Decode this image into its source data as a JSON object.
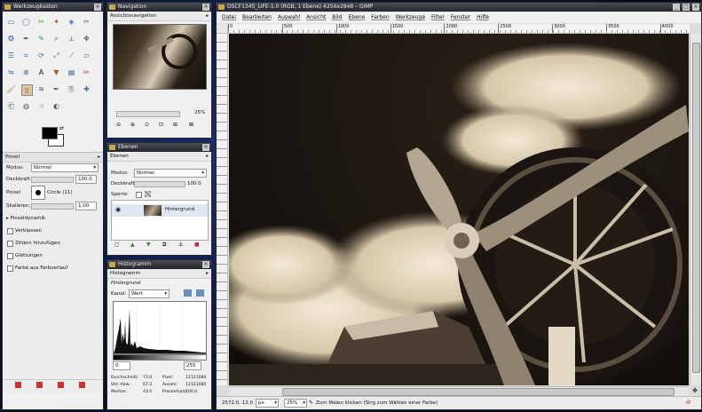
{
  "toolbox": {
    "title": "Werkzeugkasten",
    "tool_icons": [
      "rect-select",
      "ellipse-select",
      "free-select",
      "fuzzy-select",
      "color-select",
      "scissors",
      "foreground-select",
      "paths",
      "color-picker",
      "zoom",
      "measure",
      "move",
      "align",
      "crop",
      "rotate",
      "scale",
      "shear",
      "perspective",
      "flip",
      "cage",
      "text",
      "bucket-fill",
      "blend",
      "pencil",
      "paintbrush",
      "eraser",
      "airbrush",
      "ink",
      "clone",
      "heal",
      "perspective-clone",
      "blur",
      "smudge",
      "dodge-burn"
    ],
    "fg_color": "#000000",
    "bg_color": "#ffffff",
    "options": {
      "section": "Pinsel",
      "mode_label": "Modus:",
      "mode_value": "Normal",
      "opacity_label": "Deckkraft",
      "opacity_value": "100.0",
      "brush_label": "Pinsel",
      "brush_value": "Circle (11)",
      "scale_label": "Skalieren:",
      "scale_value": "1.00",
      "dynamics_label": "Pinseldynamik",
      "checkboxes": [
        "Verblassen",
        "Zittern hinzufügen",
        "Glättungen",
        "Farbe aus Farbverlauf"
      ]
    }
  },
  "navigation": {
    "title": "Navigation",
    "header": "Ansichtsnavigation",
    "zoom": "25%"
  },
  "layers": {
    "title": "Ebenen",
    "header": "Ebenen",
    "mode_label": "Modus:",
    "mode_value": "Normal",
    "opacity_label": "Deckkraft",
    "opacity_value": "100.0",
    "lock_label": "Sperre:",
    "layer_name": "Hintergrund"
  },
  "histogram": {
    "title": "Histogramm",
    "header": "Histogramm",
    "sub": "Hintergrund",
    "channel_label": "Kanal:",
    "channel_value": "Wert",
    "range_min": "0",
    "range_max": "255",
    "stats": [
      [
        "Durchschnitt:",
        "73.0",
        "Pixel:",
        "12121080"
      ],
      [
        "Std.-Abw.:",
        "67.3",
        "Anzahl:",
        "12121080"
      ],
      [
        "Median:",
        "43.0",
        "Prozentsatz:",
        "100.0"
      ]
    ]
  },
  "image_window": {
    "title": "DSCF1345_LIFE-1.0 (RGB, 1 Ebene) 4256x2848 – GIMP",
    "menu": [
      "Datei",
      "Bearbeiten",
      "Auswahl",
      "Ansicht",
      "Bild",
      "Ebene",
      "Farben",
      "Werkzeuge",
      "Filter",
      "Fenster",
      "Hilfe"
    ],
    "ruler_ticks": [
      "0",
      "500",
      "1000",
      "1500",
      "2000",
      "2500",
      "3000",
      "3500",
      "4000"
    ],
    "status": {
      "coords": "2572.0, 12.0",
      "unit": "px",
      "zoom": "25%",
      "message": "Zum Malen klicken (Strg zum Wählen einer Farbe)"
    }
  }
}
